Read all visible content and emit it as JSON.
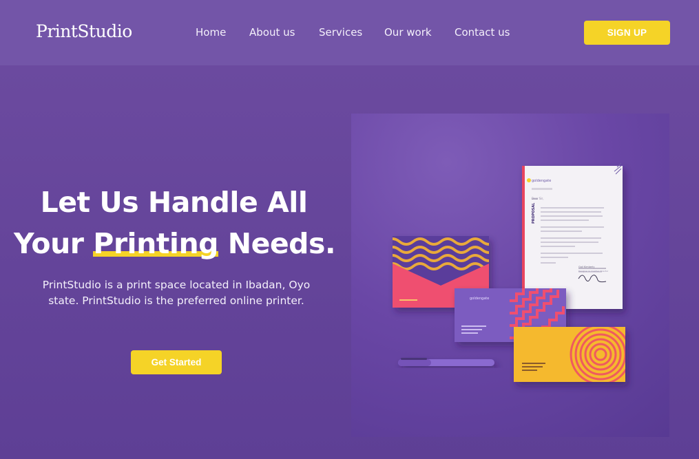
{
  "nav": {
    "logo": "PrintStudio",
    "items": [
      {
        "label": "Home"
      },
      {
        "label": "About us"
      },
      {
        "label": "Services"
      },
      {
        "label": "Our work"
      },
      {
        "label": "Contact us"
      }
    ],
    "signup_label": "SIGN UP"
  },
  "hero": {
    "headline_line1": "Let Us Handle All",
    "headline_line2_pre": "Your ",
    "headline_highlight": "Printing",
    "headline_line2_post": " Needs.",
    "description": "PrintStudio is a print space located in Ibadan, Oyo state. PrintStudio is the preferred online printer.",
    "cta_label": "Get Started"
  },
  "mockup": {
    "brand": "goldengate",
    "doc_side_label": "PROPOSAL",
    "doc_greeting": "Dear Sir,",
    "doc_signer": "Gail Kimberly",
    "doc_signer_title": "Designer & Creative Director"
  },
  "colors": {
    "background": "#6c4ca0",
    "nav_background": "#7355a8",
    "accent": "#f5d327"
  }
}
